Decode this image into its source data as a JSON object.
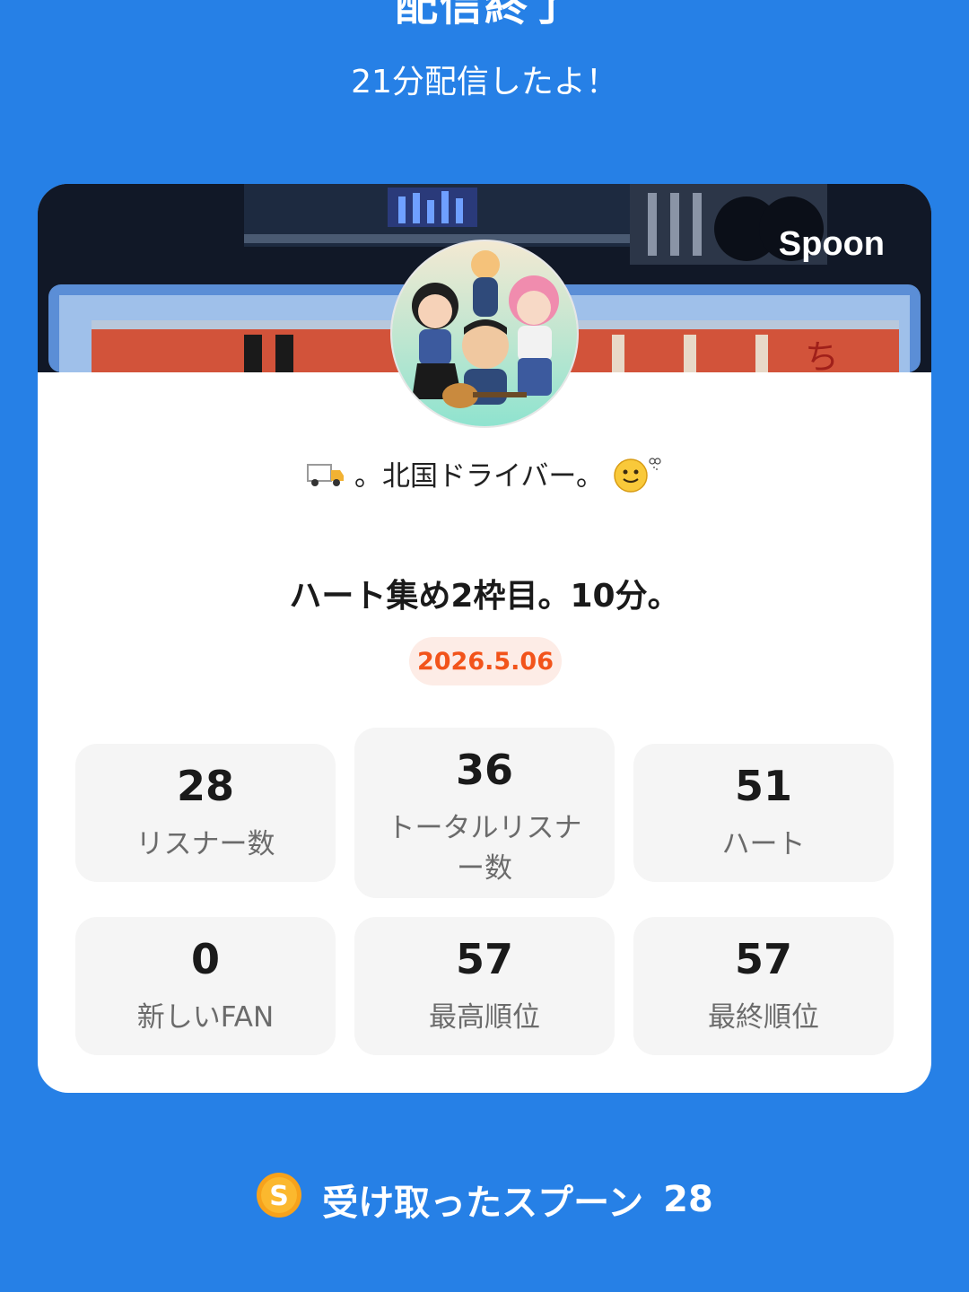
{
  "header": {
    "title": "配信終了",
    "subtitle": "21分配信したよ！"
  },
  "card": {
    "brand": "Spoon",
    "dj_name": "。北国ドライバー。",
    "live_title": "ハート集め2枠目。10分。",
    "date": "2026.5.06",
    "stats": [
      {
        "value": "28",
        "label": "リスナー数"
      },
      {
        "value": "36",
        "label": "トータルリスナー数"
      },
      {
        "value": "51",
        "label": "ハート"
      },
      {
        "value": "0",
        "label": "新しいFAN"
      },
      {
        "value": "57",
        "label": "最高順位"
      },
      {
        "value": "57",
        "label": "最終順位"
      }
    ]
  },
  "spoons": {
    "label": "受け取ったスプーン",
    "count": "28",
    "icon": "spoon-coin-icon"
  },
  "colors": {
    "background": "#2680e6",
    "date_text": "#f2541b",
    "date_bg": "#fdece6",
    "coin": "#f7a21b"
  }
}
